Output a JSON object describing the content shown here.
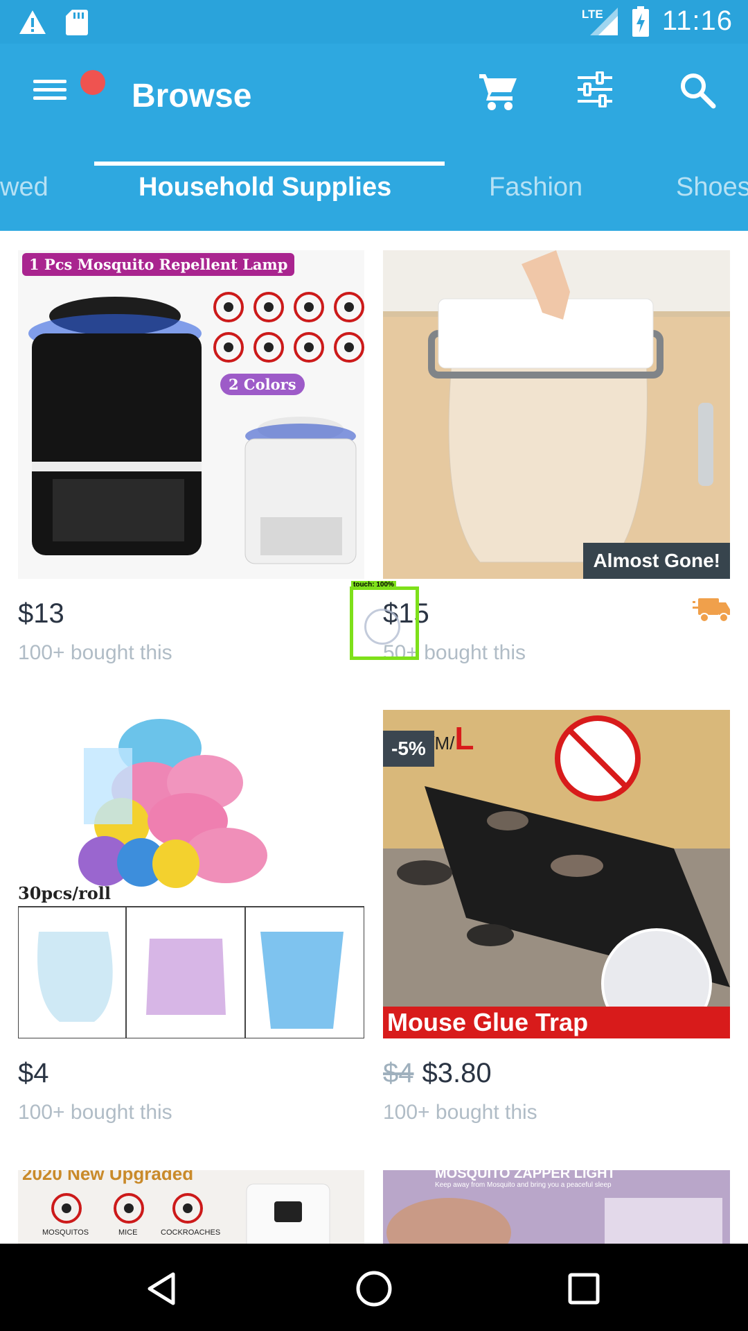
{
  "status_bar": {
    "time": "11:16",
    "network": "LTE",
    "icons": [
      "warning-icon",
      "sd-card-icon",
      "signal-icon",
      "battery-charging-icon"
    ]
  },
  "app_bar": {
    "title": "Browse",
    "actions": [
      "cart-icon",
      "filter-icon",
      "search-icon"
    ]
  },
  "tabs": [
    {
      "label": "wed",
      "active": false
    },
    {
      "label": "Household Supplies",
      "active": true
    },
    {
      "label": "Fashion",
      "active": false
    },
    {
      "label": "Shoes",
      "active": false
    }
  ],
  "products": [
    {
      "price": "$13",
      "bought": "100+ bought this",
      "image_text": "1 Pcs Mosquito Repellent Lamp",
      "image_text2": "2 Colors"
    },
    {
      "price": "$15",
      "bought": "50+ bought this",
      "badge": "Almost Gone!",
      "shipping": "truck-icon"
    },
    {
      "price": "$4",
      "bought": "100+ bought this",
      "image_text": "30pcs/roll"
    },
    {
      "old_price": "$4",
      "price": "$3.80",
      "bought": "100+ bought this",
      "badge": "-5%",
      "image_text": "Mouse Glue Trap",
      "image_size_text": "XS/S/M/",
      "image_size_l": "L"
    },
    {
      "image_text": "2020 New Upgraded",
      "labels": [
        "MOSQUITOS",
        "MICE",
        "COCKROACHES"
      ]
    },
    {
      "image_text": "MOSQUITO ZAPPER LIGHT",
      "image_sub": "Keep away from Mosquito and bring you a peaceful sleep"
    }
  ],
  "touch": {
    "label": "touch: 100%"
  },
  "colors": {
    "appbar": "#2ea8e0",
    "statusbar": "#2aa3db",
    "truck": "#f0a04b"
  }
}
